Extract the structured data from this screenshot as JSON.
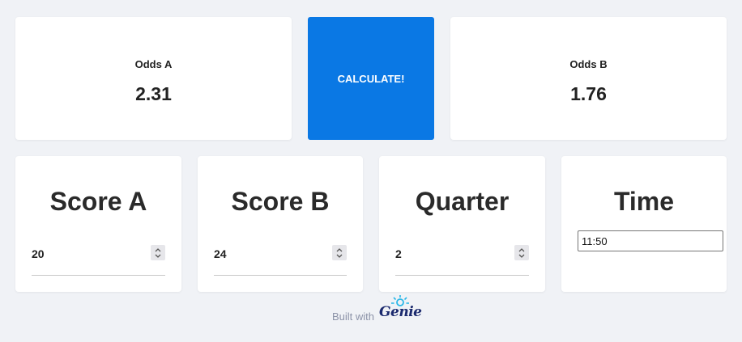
{
  "odds": {
    "a": {
      "label": "Odds A",
      "value": "2.31"
    },
    "b": {
      "label": "Odds B",
      "value": "1.76"
    }
  },
  "calculate": {
    "label": "CALCULATE!"
  },
  "stats": {
    "score_a": {
      "title": "Score A",
      "value": "20"
    },
    "score_b": {
      "title": "Score B",
      "value": "24"
    },
    "quarter": {
      "title": "Quarter",
      "value": "2"
    },
    "time": {
      "title": "Time",
      "value": "11:50"
    }
  },
  "footer": {
    "text": "Built with",
    "brand": "Genie"
  },
  "colors": {
    "accent": "#0a78e4",
    "background": "#f0f2f6",
    "brand": "#1b2a6e",
    "brand_spark": "#2ab7e8"
  }
}
